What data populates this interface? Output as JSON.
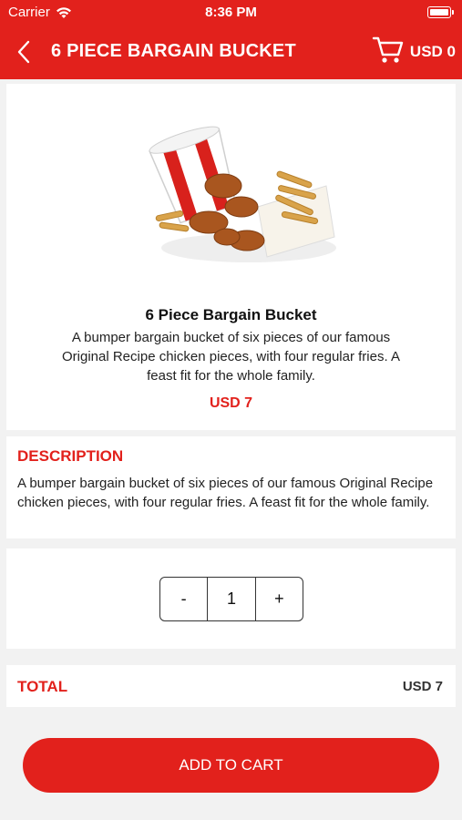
{
  "status_bar": {
    "carrier": "Carrier",
    "time": "8:36 PM"
  },
  "header": {
    "title": "6 PIECE BARGAIN BUCKET",
    "cart_total": "USD 0",
    "back_icon": "chevron-left-icon",
    "cart_icon": "shopping-cart-icon"
  },
  "product": {
    "name": "6 Piece Bargain Bucket",
    "short_description": "A bumper bargain bucket of six pieces of our famous Original Recipe chicken pieces, with four regular fries. A feast fit for the whole family.",
    "price": "USD 7"
  },
  "description": {
    "title": "DESCRIPTION",
    "body": "A bumper bargain bucket of six pieces of our famous Original Recipe chicken pieces, with four regular fries. A feast fit for the whole family."
  },
  "quantity": {
    "minus_label": "-",
    "value": "1",
    "plus_label": "+"
  },
  "total": {
    "label": "TOTAL",
    "value": "USD 7"
  },
  "add_to_cart": {
    "label": "ADD TO CART"
  },
  "colors": {
    "brand_red": "#e2211c",
    "background": "#f2f2f2"
  }
}
